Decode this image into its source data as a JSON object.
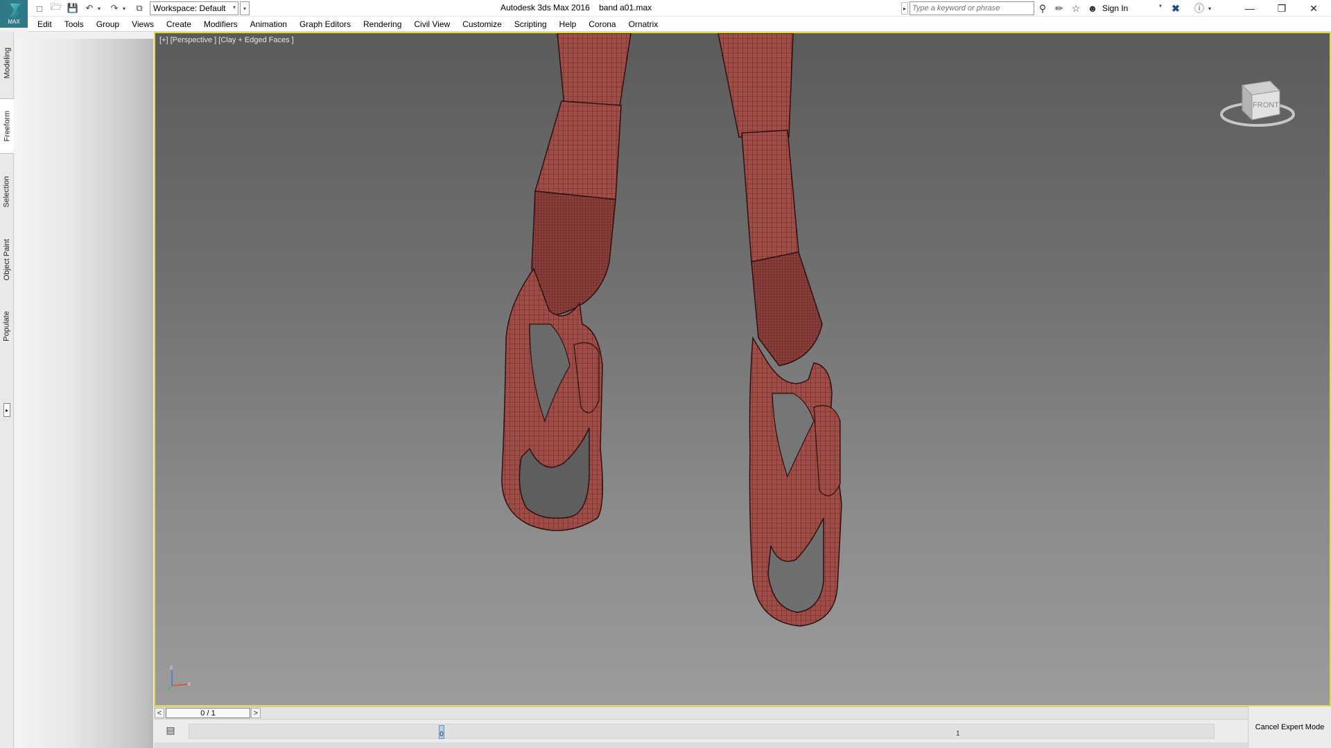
{
  "app": {
    "logo_text": "MAX",
    "title": "Autodesk 3ds Max 2016",
    "file_name": "band a01.max"
  },
  "toolbar": {
    "workspace": "Workspace: Default",
    "search_placeholder": "Type a keyword or phrase",
    "sign_in": "Sign In"
  },
  "menu": {
    "items": [
      "Edit",
      "Tools",
      "Group",
      "Views",
      "Create",
      "Modifiers",
      "Animation",
      "Graph Editors",
      "Rendering",
      "Civil View",
      "Customize",
      "Scripting",
      "Help",
      "Corona",
      "Ornatrix"
    ]
  },
  "ribbon": {
    "tabs": [
      "Modeling",
      "Freeform",
      "Selection",
      "Object Paint",
      "Populate"
    ],
    "active_tab": "Freeform"
  },
  "viewport": {
    "label": "[+] [Perspective ] [Clay + Edged Faces ]",
    "viewcube_face": "FRONT",
    "axis_z": "z",
    "axis_x": "x",
    "border_color": "#e3d84a",
    "mesh_color": "#9a4a45"
  },
  "timeline": {
    "frame_display": "0 / 1",
    "prev": "<",
    "next": ">",
    "tick_start": "0",
    "tick_end": "1"
  },
  "status": {
    "expert_mode_button": "Cancel Expert Mode"
  },
  "icons": [
    "new-file-icon",
    "open-folder-icon",
    "save-icon",
    "undo-icon",
    "redo-icon",
    "project-icon",
    "binoculars-icon",
    "favorites-icon",
    "star-icon",
    "user-icon",
    "x-exchange-icon",
    "help-icon",
    "minimize-icon",
    "restore-icon",
    "close-icon"
  ]
}
